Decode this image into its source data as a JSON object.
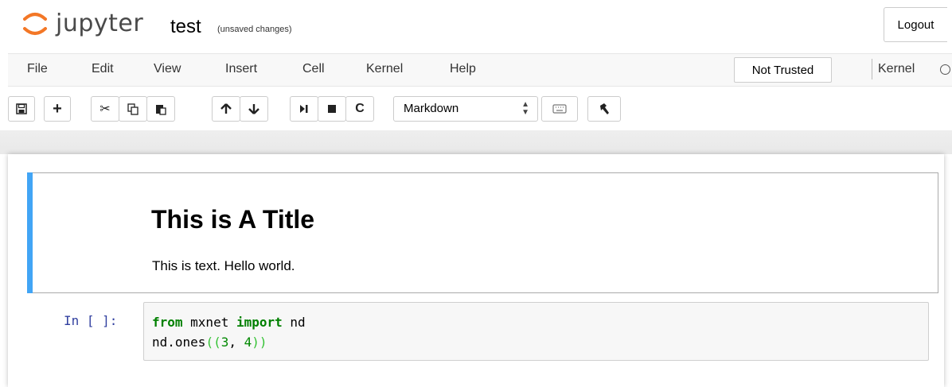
{
  "header": {
    "logo_text": "jupyter",
    "notebook_name": "test",
    "save_status": "(unsaved changes)",
    "logout_label": "Logout"
  },
  "menubar": {
    "items": [
      "File",
      "Edit",
      "View",
      "Insert",
      "Cell",
      "Kernel",
      "Help"
    ],
    "trusted_label": "Not Trusted",
    "kernel_label": "Kernel"
  },
  "toolbar": {
    "buttons": [
      "save-icon",
      "plus-icon",
      "cut-icon",
      "copy-icon",
      "paste-icon",
      "arrow-up-icon",
      "arrow-down-icon",
      "step-forward-icon",
      "stop-icon",
      "restart-icon",
      "keyboard-icon",
      "hammer-icon"
    ],
    "cell_type": "Markdown"
  },
  "cells": {
    "markdown": {
      "title": "This is A Title",
      "text": "This is text. Hello world."
    },
    "code": {
      "prompt": "In [ ]:",
      "line1": {
        "kw1": "from",
        "mod": " mxnet ",
        "kw2": "import",
        "name": " nd"
      },
      "line2": {
        "call": "nd.ones",
        "open": "((",
        "a": "3",
        "sep": ", ",
        "b": "4",
        "close": "))"
      }
    }
  },
  "colors": {
    "accent_blue": "#42a5f5",
    "prompt_blue": "#303f9f",
    "keyword_green": "#008000"
  }
}
